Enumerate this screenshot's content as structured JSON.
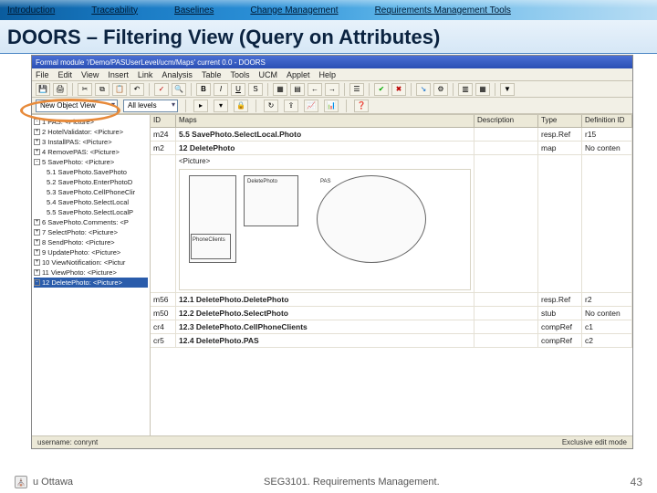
{
  "nav": {
    "items": [
      "Introduction",
      "Traceability",
      "Baselines",
      "Change Management",
      "Requirements Management Tools"
    ]
  },
  "slide": {
    "title": "DOORS – Filtering View (Query on Attributes)"
  },
  "window": {
    "title": "Formal module '/Demo/PASUserLevel/ucm/Maps' current 0.0 - DOORS",
    "menus": [
      "File",
      "Edit",
      "View",
      "Insert",
      "Link",
      "Analysis",
      "Table",
      "Tools",
      "UCM",
      "Applet",
      "Help"
    ],
    "view_combo": "New Object View",
    "level_combo": "All levels",
    "status_left": "username: conrynt",
    "status_right": "Exclusive edit mode"
  },
  "columns": {
    "id": "ID",
    "main": "Maps",
    "desc": "Description",
    "type": "Type",
    "def": "Definition ID"
  },
  "tree": {
    "items": [
      {
        "label": "1 PAS: <Picture>",
        "exp": "-"
      },
      {
        "label": "2 HotelValidator: <Picture>",
        "exp": "+"
      },
      {
        "label": "3 InstallPAS: <Picture>",
        "exp": "+"
      },
      {
        "label": "4 RemovePAS: <Picture>",
        "exp": "+"
      },
      {
        "label": "5 SavePhoto: <Picture>",
        "exp": "-"
      },
      {
        "label": "5.1 SavePhoto.SavePhoto",
        "child": true
      },
      {
        "label": "5.2 SavePhoto.EnterPhotoD",
        "child": true
      },
      {
        "label": "5.3 SavePhoto.CellPhoneClir",
        "child": true
      },
      {
        "label": "5.4 SavePhoto.SelectLocal",
        "child": true
      },
      {
        "label": "5.5 SavePhoto.SelectLocalP",
        "child": true
      },
      {
        "label": "6 SavePhoto.Comments: <P",
        "exp": "+"
      },
      {
        "label": "7 SelectPhoto: <Picture>",
        "exp": "+"
      },
      {
        "label": "8 SendPhoto: <Picture>",
        "exp": "+"
      },
      {
        "label": "9 UpdatePhoto: <Picture>",
        "exp": "+"
      },
      {
        "label": "10 ViewNotification: <Pictur",
        "exp": "+"
      },
      {
        "label": "11 ViewPhoto: <Picture>",
        "exp": "+"
      },
      {
        "label": "12 DeletePhoto: <Picture>",
        "exp": "-",
        "sel": true
      }
    ]
  },
  "rows": [
    {
      "id": "m24",
      "main": "5.5 SavePhoto.SelectLocal.Photo",
      "desc": "",
      "type": "resp.Ref",
      "def": "r15"
    },
    {
      "id": "m2",
      "main": "12 DeletePhoto",
      "desc": "",
      "type": "map",
      "def": "No conten"
    },
    {
      "id": "",
      "main": "<Picture>",
      "picture": true
    },
    {
      "id": "m56",
      "main": "12.1 DeletePhoto.DeletePhoto",
      "desc": "",
      "type": "resp.Ref",
      "def": "r2"
    },
    {
      "id": "m50",
      "main": "12.2 DeletePhoto.SelectPhoto",
      "desc": "",
      "type": "stub",
      "def": "No conten"
    },
    {
      "id": "cr4",
      "main": "12.3 DeletePhoto.CellPhoneClients",
      "desc": "",
      "type": "compRef",
      "def": "c1"
    },
    {
      "id": "cr5",
      "main": "12.4 DeletePhoto.PAS",
      "desc": "",
      "type": "compRef",
      "def": "c2"
    }
  ],
  "footer": {
    "uni": "u Ottawa",
    "course": "SEG3101. Requirements Management.",
    "page": "43"
  }
}
